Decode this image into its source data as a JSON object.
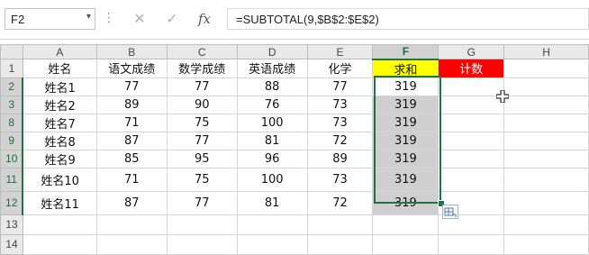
{
  "formula_bar": {
    "name_box": "F2",
    "name_box_arrow": "▾",
    "dots": "⋮",
    "cancel_glyph": "✕",
    "enter_glyph": "✓",
    "fx_glyph": "fx",
    "formula": "=SUBTOTAL(9,$B$2:$E$2)"
  },
  "columns": [
    "A",
    "B",
    "C",
    "D",
    "E",
    "F",
    "G",
    "H"
  ],
  "rows": [
    {
      "num": "1",
      "cells": [
        "姓名",
        "语文成绩",
        "数学成绩",
        "英语成绩",
        "化学",
        "求和",
        "计数",
        ""
      ]
    },
    {
      "num": "2",
      "cells": [
        "姓名1",
        "77",
        "77",
        "88",
        "77",
        "319",
        "",
        ""
      ]
    },
    {
      "num": "3",
      "cells": [
        "姓名2",
        "89",
        "90",
        "76",
        "73",
        "319",
        "",
        ""
      ]
    },
    {
      "num": "8",
      "cells": [
        "姓名7",
        "71",
        "75",
        "100",
        "73",
        "319",
        "",
        ""
      ]
    },
    {
      "num": "9",
      "cells": [
        "姓名8",
        "87",
        "77",
        "81",
        "72",
        "319",
        "",
        ""
      ]
    },
    {
      "num": "10",
      "cells": [
        "姓名9",
        "85",
        "95",
        "96",
        "89",
        "319",
        "",
        ""
      ]
    },
    {
      "num": "11",
      "cells": [
        "姓名10",
        "71",
        "75",
        "100",
        "73",
        "319",
        "",
        ""
      ]
    },
    {
      "num": "12",
      "cells": [
        "姓名11",
        "87",
        "77",
        "81",
        "72",
        "319",
        "",
        ""
      ]
    },
    {
      "num": "13",
      "cells": [
        "",
        "",
        "",
        "",
        "",
        "",
        "",
        ""
      ]
    },
    {
      "num": "14",
      "cells": [
        "",
        "",
        "",
        "",
        "",
        "",
        "",
        ""
      ]
    }
  ],
  "colors": {
    "header_fill_sum": "#ffff00",
    "header_fill_count": "#ff0000",
    "selection": "#217346"
  }
}
